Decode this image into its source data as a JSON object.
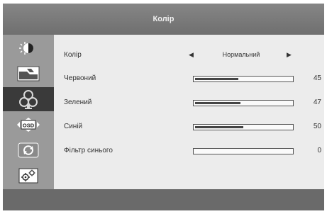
{
  "title": "Колір",
  "sidebar": {
    "items": [
      {
        "icon": "brightness-contrast-icon",
        "active": false
      },
      {
        "icon": "image-adjust-icon",
        "active": false
      },
      {
        "icon": "color-icon",
        "active": true
      },
      {
        "icon": "osd-icon",
        "label": "OSD",
        "active": false
      },
      {
        "icon": "reset-icon",
        "active": false
      },
      {
        "icon": "settings-gears-icon",
        "active": false
      }
    ]
  },
  "menu": {
    "color_mode": {
      "label": "Колір",
      "value": "Нормальний"
    },
    "rows": [
      {
        "label": "Червоний",
        "value": 45,
        "display": "45"
      },
      {
        "label": "Зелений",
        "value": 47,
        "display": "47"
      },
      {
        "label": "Синій",
        "value": 50,
        "display": "50"
      },
      {
        "label": "Фільтр синього",
        "value": 0,
        "display": "0"
      }
    ]
  },
  "colors": {
    "active_item": "#3a3a3a",
    "panel": "#ececec",
    "frame": "#666666"
  }
}
